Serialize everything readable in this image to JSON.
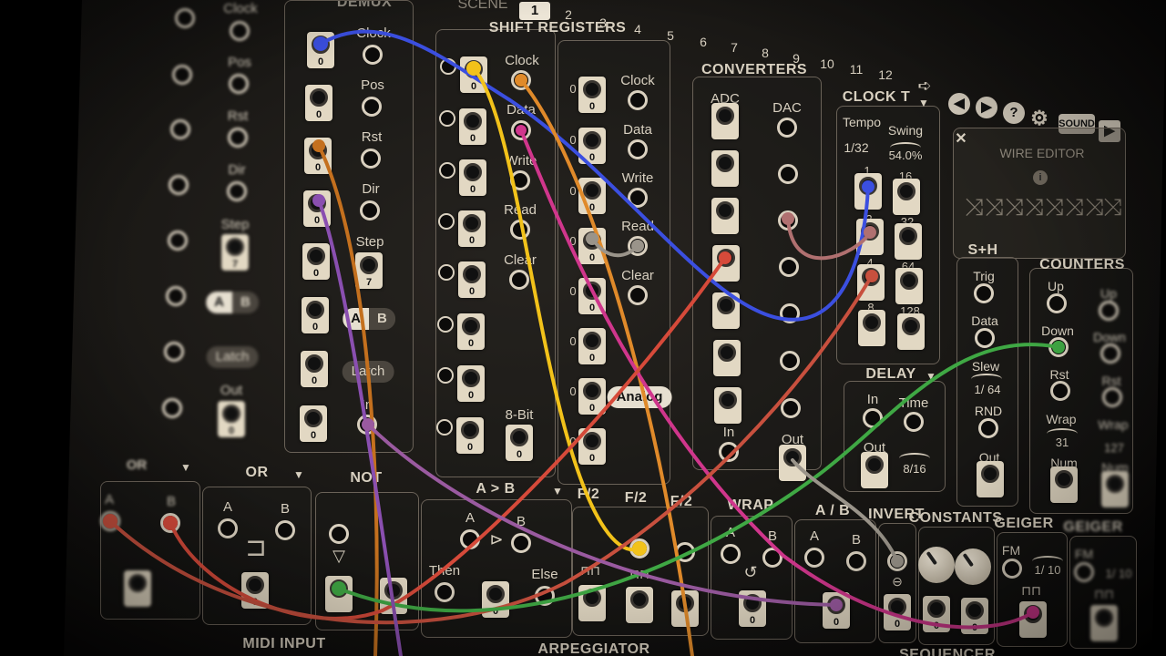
{
  "header": {
    "demux_title": "DEMUX",
    "scene_label": "SCENE",
    "scene_selected": "1",
    "scene_numbers": [
      "2",
      "3",
      "4",
      "5",
      "6",
      "7",
      "8",
      "9",
      "10",
      "11",
      "12"
    ]
  },
  "left_module": {
    "labels": [
      "Clock",
      "Pos",
      "Rst",
      "Dir",
      "Step"
    ],
    "step_value": "7",
    "ab_a": "A",
    "ab_b": "B",
    "latch": "Latch",
    "out": "Out",
    "out_value": "0"
  },
  "demux": {
    "labels": [
      "Clock",
      "Pos",
      "Rst",
      "Dir",
      "Step"
    ],
    "step_value": "7",
    "ab_a": "A",
    "ab_b": "B",
    "latch": "Latch",
    "in": "In",
    "port_values": [
      "0",
      "0",
      "0",
      "0",
      "0",
      "0",
      "0",
      "0"
    ]
  },
  "shift_registers": {
    "title": "SHIFT REGISTERS",
    "left_labels": [
      "Clock",
      "Data",
      "Write",
      "Read",
      "Clear"
    ],
    "right_labels": [
      "Clock",
      "Data",
      "Write",
      "Read",
      "Clear"
    ],
    "bit_label": "8-Bit",
    "bit_value": "0",
    "analog": "Analog",
    "port_values": [
      "0",
      "0",
      "0",
      "0",
      "0",
      "0",
      "0",
      "0"
    ]
  },
  "converters": {
    "title": "CONVERTERS",
    "adc": "ADC",
    "dac": "DAC",
    "in": "In"
  },
  "clock_t": {
    "title": "CLOCK T",
    "tempo_label": "Tempo",
    "tempo_value": "1/32",
    "swing_label": "Swing",
    "swing_value": "54.0%",
    "outputs": [
      "1",
      "16",
      "2",
      "32",
      "4",
      "64",
      "8",
      "128"
    ]
  },
  "toolbar": {
    "back_icon": "◀",
    "forward_icon": "▶",
    "help": "?",
    "settings": "⚙",
    "sound": "SOUND",
    "play": "▶"
  },
  "wire_editor": {
    "title": "WIRE EDITOR",
    "close": "✕",
    "info": "i"
  },
  "sample_hold": {
    "title": "S+H",
    "trig": "Trig",
    "data": "Data",
    "slew": "Slew",
    "slew_value": "1/ 64",
    "rnd": "RND",
    "out": "Out"
  },
  "counters": {
    "title": "COUNTERS",
    "up": "Up",
    "down": "Down",
    "rst": "Rst",
    "wrap": "Wrap",
    "wrap_value_a": "31",
    "wrap_value_b": "127",
    "num": "Num"
  },
  "delay": {
    "title": "DELAY",
    "in": "In",
    "time": "Time",
    "out": "Out",
    "time_value": "8/16"
  },
  "bottom_row": {
    "xor": "OR",
    "or": "OR",
    "not": "NOT",
    "a_gt_b": "A > B",
    "f2a": "F/2",
    "f2b": "F/2",
    "f2c": "F/2",
    "wrap": "WRAP",
    "a_b": "A / B",
    "invert": "INVERT",
    "constants": "CONSTANTS",
    "geiger_a": "GEIGER",
    "geiger_b": "GEIGER",
    "a": "A",
    "b": "B",
    "then": "Then",
    "else": "Else",
    "fm": "FM",
    "fm_value": "1/ 10",
    "midi_input": "MIDI INPUT",
    "arpeggiator": "ARPEGGIATOR",
    "sequencer": "SEQUENCER",
    "zero": "0"
  },
  "colors": {
    "cable_blue": "#3b4fe0",
    "cable_yellow": "#f2c21a",
    "cable_orange": "#e08a2a",
    "cable_magenta": "#d0368c",
    "cable_red": "#d64a3a",
    "cable_green": "#3fa844",
    "cable_purple": "#8a4fb0",
    "cable_mauve": "#b07070",
    "cable_grey": "#9a948a",
    "cable_brown": "#9a5a2a"
  }
}
